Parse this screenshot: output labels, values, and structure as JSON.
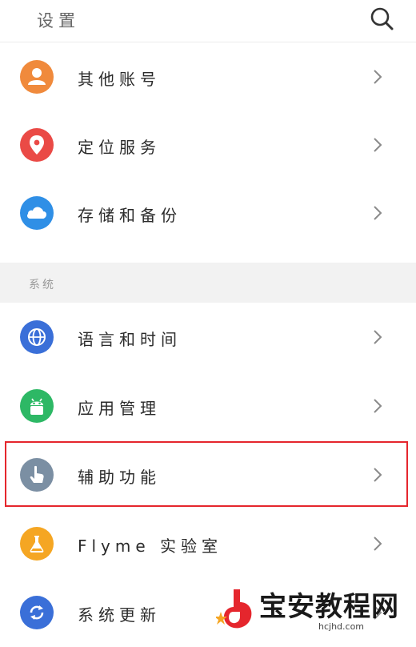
{
  "header": {
    "title": "设置",
    "search_icon": "search-icon"
  },
  "items_top": [
    {
      "label": "其他账号",
      "icon": "person-icon",
      "color": "#f08a3c"
    },
    {
      "label": "定位服务",
      "icon": "location-pin-icon",
      "color": "#ea4a46"
    },
    {
      "label": "存储和备份",
      "icon": "cloud-icon",
      "color": "#2f8fe6"
    }
  ],
  "section": {
    "label": "系统"
  },
  "items_system": [
    {
      "label": "语言和时间",
      "icon": "globe-icon",
      "color": "#3a6fd8"
    },
    {
      "label": "应用管理",
      "icon": "android-icon",
      "color": "#2db865"
    },
    {
      "label": "辅助功能",
      "icon": "hand-pointer-icon",
      "color": "#7b8fa3"
    },
    {
      "label": "Flyme 实验室",
      "icon": "flask-icon",
      "color": "#f5a623"
    },
    {
      "label": "系统更新",
      "icon": "refresh-icon",
      "color": "#3a6fd8"
    }
  ],
  "watermark": {
    "text": "宝安教程网",
    "url": "hcjhd.com",
    "accent": "#e5262d"
  }
}
